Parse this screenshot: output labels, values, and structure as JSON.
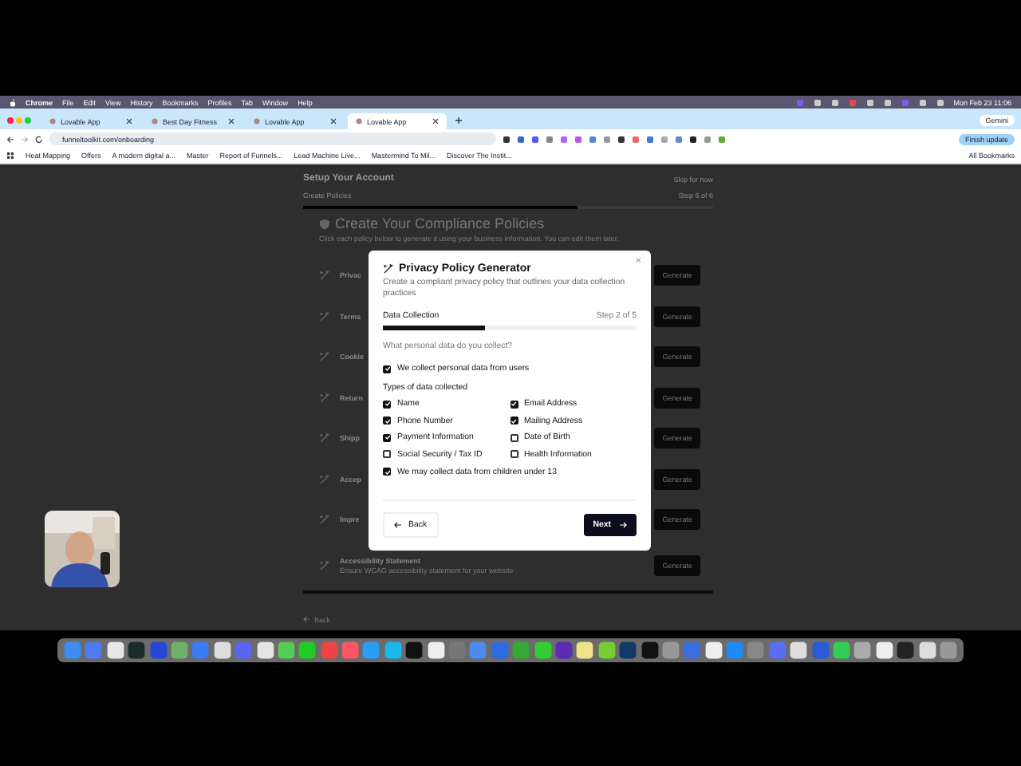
{
  "menu_bar": {
    "items": [
      "Chrome",
      "File",
      "Edit",
      "View",
      "History",
      "Bookmarks",
      "Profiles",
      "Tab",
      "Window",
      "Help"
    ],
    "clock": "Mon Feb 23 11:06"
  },
  "browser": {
    "tabs": [
      {
        "label": "Lovable App",
        "selected": false
      },
      {
        "label": "Best Day Fitness",
        "selected": false
      },
      {
        "label": "Lovable App",
        "selected": false
      },
      {
        "label": "Lovable App",
        "selected": true
      }
    ],
    "gemini": "Gemini",
    "url": "funneltoolkit.com/onboarding",
    "update_button": "Finish update",
    "bookmarks": [
      "Heat Mapping",
      "Offers",
      "A modern digital a...",
      "Master",
      "Report of Funnels...",
      "Lead Machine Live...",
      "Mastermind To Mil...",
      "Discover The Instit..."
    ],
    "all_bookmarks": "All Bookmarks"
  },
  "page": {
    "title": "Setup Your Account",
    "skip": "Skip for now",
    "section": "Create Policies",
    "step": "Step 6 of 6",
    "level": 0.67,
    "heading": "Create Your Compliance Policies",
    "subtitle": "Click each policy below to generate it using your business information. You can edit them later.",
    "policies": [
      {
        "title": "Privac",
        "button": "Generate"
      },
      {
        "title": "Terms",
        "button": "Generate"
      },
      {
        "title": "Cookie",
        "button": "Generate"
      },
      {
        "title": "Return",
        "button": "Generate"
      },
      {
        "title": "Shipp",
        "button": "Generate"
      },
      {
        "title": "Accep",
        "button": "Generate"
      },
      {
        "title": "Impre",
        "button": "Generate"
      },
      {
        "title": "Accessibility Statement",
        "description": "Ensure WCAG accessibility statement for your website",
        "button": "Generate"
      }
    ],
    "back": "Back"
  },
  "modal": {
    "title": "Privacy Policy Generator",
    "description": "Create a compliant privacy policy that outlines your data collection practices",
    "close": "×",
    "step_name": "Data Collection",
    "step": "Step 2 of 5",
    "level": 0.4,
    "question": "What personal data do you collect?",
    "collect": {
      "label": "We collect personal data from users",
      "checked": true
    },
    "types_label": "Types of data collected",
    "types": [
      {
        "label": "Name",
        "checked": true
      },
      {
        "label": "Email Address",
        "checked": true
      },
      {
        "label": "Phone Number",
        "checked": true
      },
      {
        "label": "Mailing Address",
        "checked": true
      },
      {
        "label": "Payment Information",
        "checked": true
      },
      {
        "label": "Date of Birth",
        "checked": false
      },
      {
        "label": "Social Security / Tax ID",
        "checked": false
      },
      {
        "label": "Health Information",
        "checked": false
      }
    ],
    "children": {
      "label": "We may collect data from children under 13",
      "checked": true
    },
    "back": "Back",
    "next": "Next"
  }
}
